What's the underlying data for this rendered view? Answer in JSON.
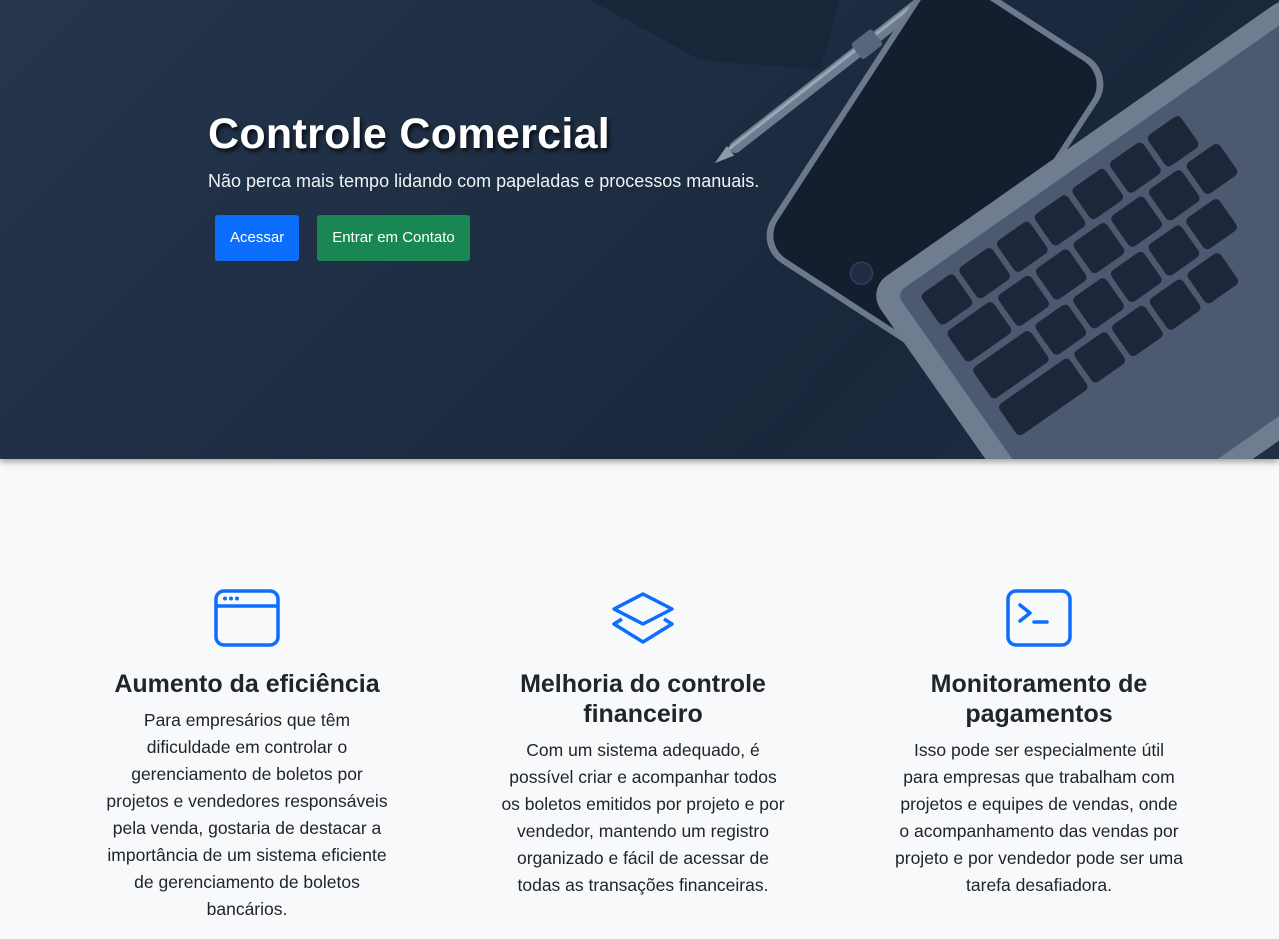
{
  "hero": {
    "title": "Controle Comercial",
    "subtitle": "Não perca mais tempo lidando com papeladas e processos manuais.",
    "buttons": {
      "primary_label": "Acessar",
      "secondary_label": "Entrar em Contato"
    }
  },
  "features": [
    {
      "icon": "browser-window-icon",
      "title": "Aumento da eficiência",
      "text": "Para empresários que têm dificuldade em controlar o gerenciamento de boletos por projetos e vendedores responsáveis pela venda, gostaria de destacar a importância de um sistema eficiente de gerenciamento de boletos bancários."
    },
    {
      "icon": "layers-icon",
      "title": "Melhoria do controle financeiro",
      "text": "Com um sistema adequado, é possível criar e acompanhar todos os boletos emitidos por projeto e por vendedor, mantendo um registro organizado e fácil de acessar de todas as transações financeiras."
    },
    {
      "icon": "terminal-icon",
      "title": "Monitoramento de pagamentos",
      "text": "Isso pode ser especialmente útil para empresas que trabalham com projetos e equipes de vendas, onde o acompanhamento das vendas por projeto e por vendedor pode ser uma tarefa desafiadora."
    }
  ],
  "colors": {
    "accent": "#0d6efd",
    "success": "#198754",
    "hero_bg": "#223349",
    "page_bg": "#f8f9fa"
  }
}
